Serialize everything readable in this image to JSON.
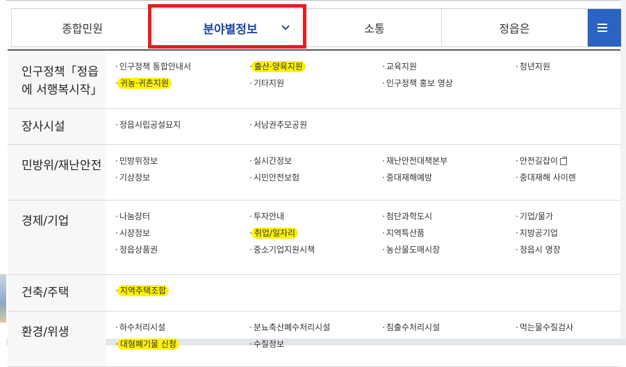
{
  "nav": {
    "items": [
      {
        "label": "종합민원"
      },
      {
        "label": "분야별정보"
      },
      {
        "label": "소통"
      },
      {
        "label": "정읍은"
      }
    ],
    "menu_icon": "hamburger-menu-icon",
    "highlight_color": "#e31e25",
    "accent_color": "#2a63c2"
  },
  "bullet": "·",
  "sections": [
    {
      "title": "인구정책「정읍에 서행복시작」",
      "links": [
        {
          "label": "인구정책 통합안내서"
        },
        {
          "label": "출산·양육지원",
          "highlight": true
        },
        {
          "label": "교육지원"
        },
        {
          "label": "청년지원"
        },
        {
          "label": "귀농·귀촌지원",
          "highlight": true
        },
        {
          "label": "기타지원"
        },
        {
          "label": "인구정책 홍보 영상"
        }
      ]
    },
    {
      "title": "장사시설",
      "links": [
        {
          "label": "정읍시립공설묘지"
        },
        {
          "label": "서남권추모공원"
        }
      ]
    },
    {
      "title": "민방위/재난안전",
      "links": [
        {
          "label": "민방위정보"
        },
        {
          "label": "실시간정보"
        },
        {
          "label": "재난안전대책본부"
        },
        {
          "label": "안전길잡이",
          "external": true
        },
        {
          "label": "기상정보"
        },
        {
          "label": "시민안전보험"
        },
        {
          "label": "중대재해예방"
        },
        {
          "label": "중대재해 사이렌"
        }
      ]
    },
    {
      "title": "경제/기업",
      "links": [
        {
          "label": "나눔장터"
        },
        {
          "label": "투자안내"
        },
        {
          "label": "첨단과학도시"
        },
        {
          "label": "기업/물가"
        },
        {
          "label": "시장정보"
        },
        {
          "label": "취업/일자리",
          "highlight": true
        },
        {
          "label": "지역특산품"
        },
        {
          "label": "지방공기업"
        },
        {
          "label": "정읍상품권"
        },
        {
          "label": "중소기업지원시책"
        },
        {
          "label": "농산물도매시장"
        },
        {
          "label": "정읍시 명장"
        }
      ]
    },
    {
      "title": "건축/주택",
      "links": [
        {
          "label": "지역주택조합",
          "highlight": true
        }
      ]
    },
    {
      "title": "환경/위생",
      "links": [
        {
          "label": "하수처리시설"
        },
        {
          "label": "분뇨축산폐수처리시설"
        },
        {
          "label": "침출수처리시설"
        },
        {
          "label": "먹는물수질검사"
        },
        {
          "label": "대형폐기물 신청",
          "highlight": true
        },
        {
          "label": "수질정보"
        }
      ]
    }
  ],
  "highlight_marker_color": "#fff200"
}
